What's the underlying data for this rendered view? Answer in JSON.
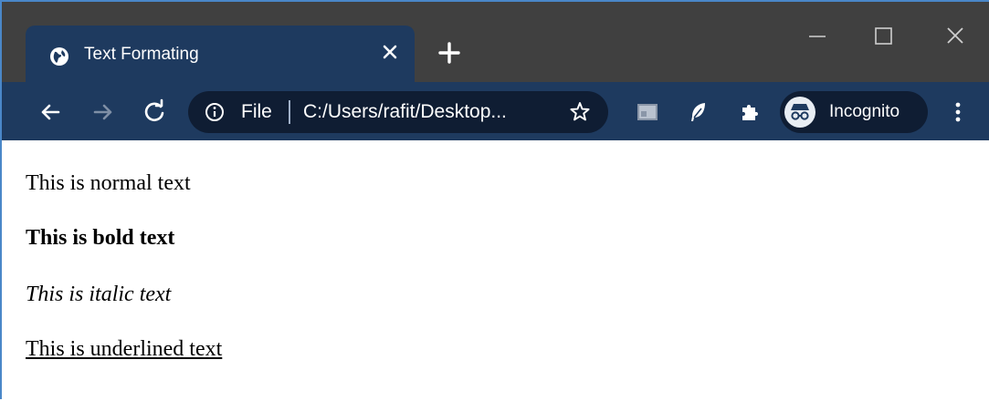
{
  "tab": {
    "title": "Text Formating",
    "favicon": "globe-icon",
    "close_icon": "close-icon"
  },
  "new_tab_icon": "plus-icon",
  "window_controls": [
    "minimize-icon",
    "maximize-icon",
    "close-icon"
  ],
  "toolbar": {
    "back_icon": "back-arrow-icon",
    "forward_icon": "forward-arrow-icon",
    "reload_icon": "reload-icon",
    "omnibox": {
      "info_icon": "info-icon",
      "scheme_label": "File",
      "url": "C:/Users/rafit/Desktop...",
      "bookmark_icon": "star-icon"
    },
    "extensions": [
      "extension-thumbnail-icon",
      "feather-icon",
      "puzzle-icon"
    ],
    "profile": {
      "icon": "incognito-icon",
      "label": "Incognito"
    },
    "menu_icon": "kebab-menu-icon"
  },
  "page": {
    "paragraphs": {
      "normal": "This is normal text",
      "bold": "This is bold text",
      "italic": "This is italic text",
      "underline": "This is underlined text"
    }
  },
  "colors": {
    "titlebar": "#404040",
    "toolbar": "#1e3a5f",
    "omnibox": "#0f1d33",
    "window_border": "#4a87c8",
    "page_text": "#000000"
  }
}
